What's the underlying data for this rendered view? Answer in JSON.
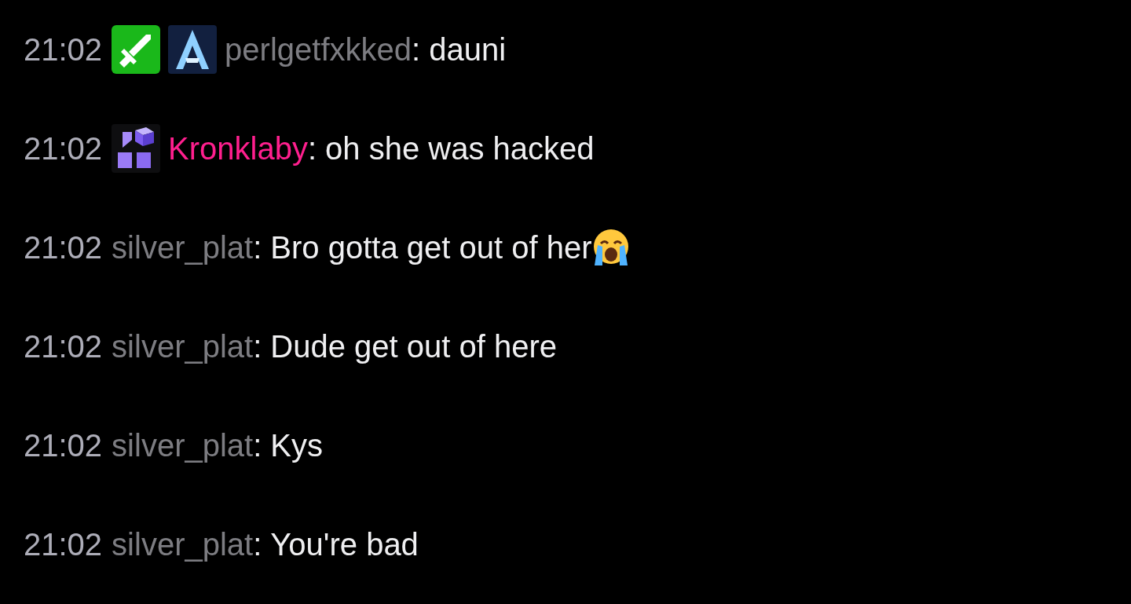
{
  "messages": [
    {
      "time": "21:02",
      "badges": [
        {
          "kind": "sword"
        },
        {
          "kind": "arc"
        }
      ],
      "username": "perlgetfxkked",
      "color": "#7d7d82",
      "separator": ":",
      "text": "dauni"
    },
    {
      "time": "21:02",
      "badges": [
        {
          "kind": "cube2024"
        }
      ],
      "username": "Kronklaby",
      "color": "#ff1f8e",
      "separator": ":",
      "text": "oh she was hacked"
    },
    {
      "time": "21:02",
      "username": "silver_plat",
      "color": "#7d7d82",
      "separator": ":",
      "text": "Bro gotta get out of her",
      "trailing_emoji": {
        "kind": "crying"
      }
    },
    {
      "time": "21:02",
      "username": "silver_plat",
      "color": "#7d7d82",
      "separator": ":",
      "text": "Dude get out of here"
    },
    {
      "time": "21:02",
      "username": "silver_plat",
      "color": "#7d7d82",
      "separator": ":",
      "text": "Kys"
    },
    {
      "time": "21:02",
      "username": "silver_plat",
      "color": "#7d7d82",
      "separator": ":",
      "text": "You're bad"
    }
  ]
}
